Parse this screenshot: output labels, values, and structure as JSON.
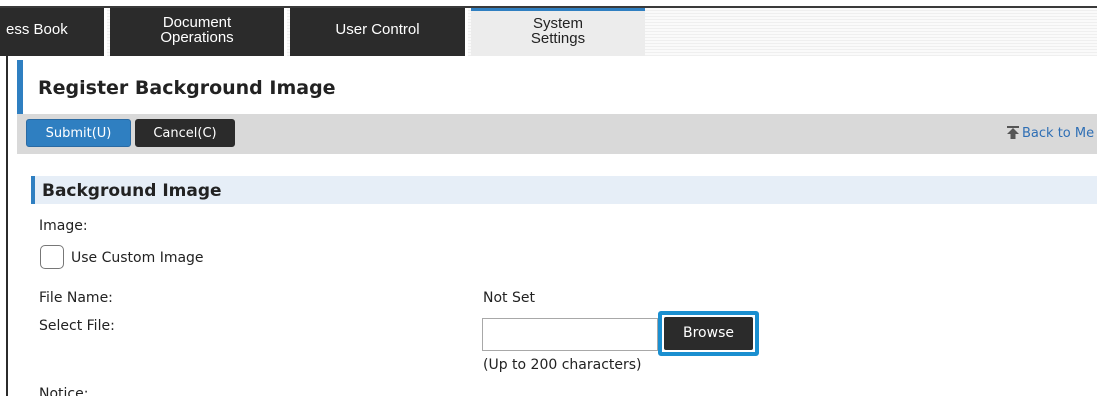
{
  "tabs": [
    {
      "label": "ess Book"
    },
    {
      "label_line1": "Document",
      "label_line2": "Operations"
    },
    {
      "label": "User Control"
    },
    {
      "label_line1": "System",
      "label_line2": "Settings",
      "active": true
    }
  ],
  "page": {
    "title": "Register Background Image"
  },
  "toolbar": {
    "submit_label": "Submit(U)",
    "cancel_label": "Cancel(C)",
    "back_label": "Back to Me"
  },
  "section": {
    "title": "Background Image"
  },
  "form": {
    "image_label": "Image:",
    "custom_image_label": "Use Custom Image",
    "custom_image_checked": false,
    "file_name_label": "File Name:",
    "file_name_value": "Not Set",
    "select_file_label": "Select File:",
    "select_file_value": "",
    "browse_label": "Browse",
    "char_limit": "(Up to 200 characters)",
    "notice_label": "Notice:"
  },
  "colors": {
    "accent": "#2f7fc1",
    "highlight": "#1a8fd0",
    "dark_button": "#2b2b2b"
  }
}
